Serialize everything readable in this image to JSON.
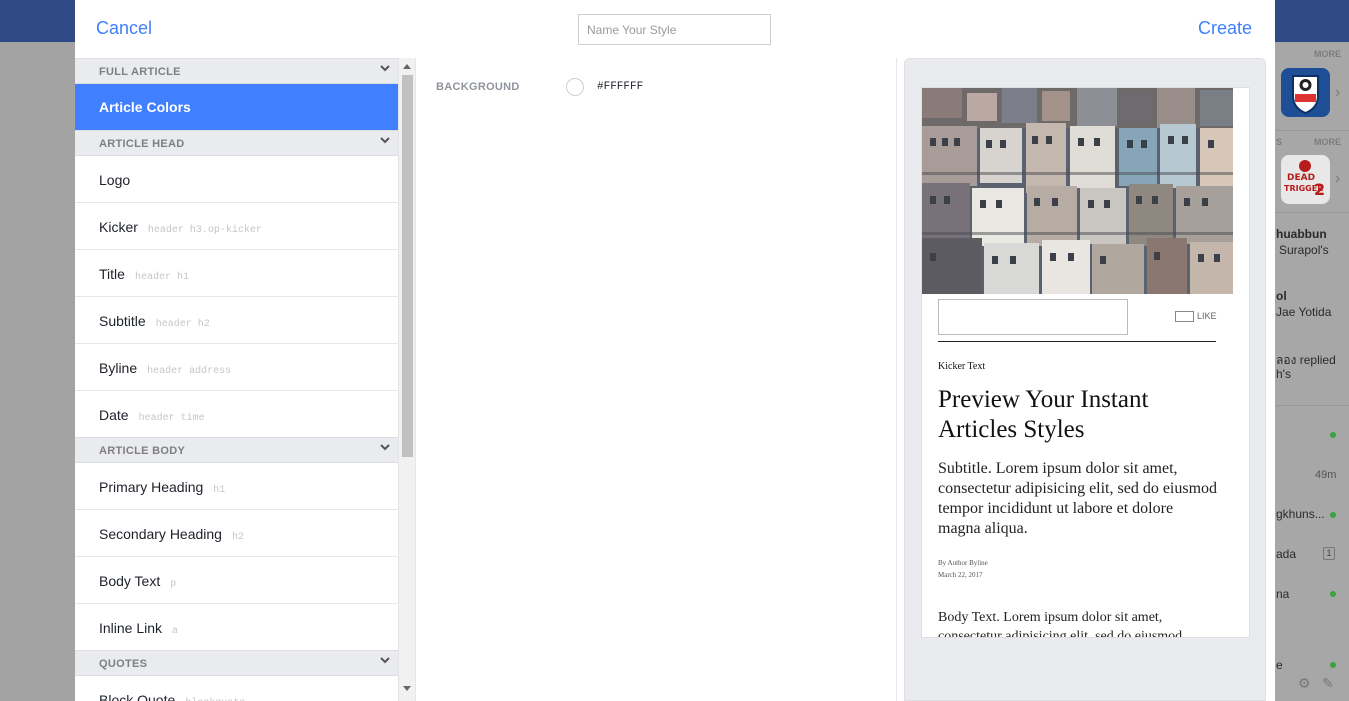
{
  "modal": {
    "cancel_label": "Cancel",
    "create_label": "Create",
    "style_name_placeholder": "Name Your Style",
    "style_name_value": ""
  },
  "sidebar": {
    "sections": [
      {
        "label": "FULL ARTICLE",
        "items": [
          {
            "label": "Article Colors",
            "selector": "",
            "active": true
          }
        ]
      },
      {
        "label": "ARTICLE HEAD",
        "items": [
          {
            "label": "Logo",
            "selector": ""
          },
          {
            "label": "Kicker",
            "selector": "header h3.op-kicker"
          },
          {
            "label": "Title",
            "selector": "header h1"
          },
          {
            "label": "Subtitle",
            "selector": "header h2"
          },
          {
            "label": "Byline",
            "selector": "header address"
          },
          {
            "label": "Date",
            "selector": "header time"
          }
        ]
      },
      {
        "label": "ARTICLE BODY",
        "items": [
          {
            "label": "Primary Heading",
            "selector": "h1"
          },
          {
            "label": "Secondary Heading",
            "selector": "h2"
          },
          {
            "label": "Body Text",
            "selector": "p"
          },
          {
            "label": "Inline Link",
            "selector": "a"
          }
        ]
      },
      {
        "label": "QUOTES",
        "items": [
          {
            "label": "Block Quote",
            "selector": "blockquote"
          }
        ]
      }
    ]
  },
  "editor": {
    "background_label": "BACKGROUND",
    "background_value": "#FFFFFF",
    "swatch_color": "#ffffff"
  },
  "preview": {
    "like_label": "LIKE",
    "kicker": "Kicker Text",
    "title": "Preview Your Instant Articles Styles",
    "subtitle": "Subtitle. Lorem ipsum dolor sit amet, consectetur adipisicing elit, sed do eiusmod tempor incididunt ut labore et dolore magna aliqua.",
    "byline": "By Author Byline",
    "date": "March 22, 2017",
    "body": "Body Text. Lorem ipsum dolor sit amet, consectetur adipisicing elit, sed do eiusmod tempor incididunt ut labore"
  },
  "background_page": {
    "more_label": "MORE",
    "more_label_short": "S",
    "app1_text": "SOCCER MANAGER 2017",
    "app2_text": "DEAD TRIGGER 2",
    "feed": [
      {
        "line1": "huabbun",
        "line2": "Surapol's"
      },
      {
        "line1": "ol",
        "line2": "Jae Yotida"
      },
      {
        "line1": "ลอง replied",
        "line2": "h's"
      }
    ],
    "chat": [
      {
        "name": ""
      },
      {
        "name": "",
        "time": "49m"
      },
      {
        "name": "gkhuns..."
      },
      {
        "name": "ada",
        "badge": "1"
      },
      {
        "name": "na"
      },
      {
        "name": "e"
      }
    ],
    "colors": {
      "accent": "#4080ff",
      "topbar": "#2f4a84",
      "online": "#3aa341"
    }
  }
}
